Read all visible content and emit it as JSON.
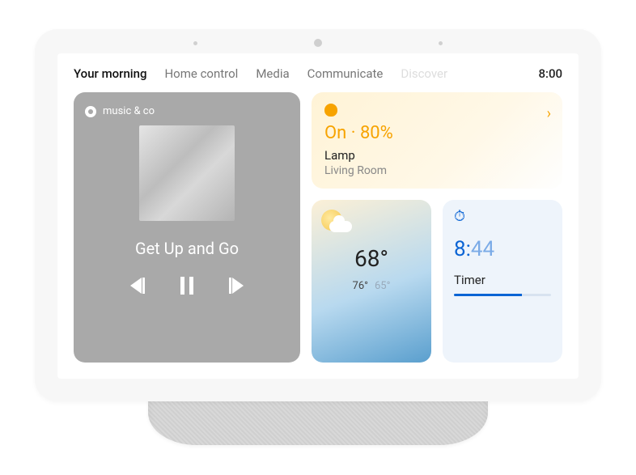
{
  "nav": {
    "tabs": [
      "Your morning",
      "Home control",
      "Media",
      "Communicate",
      "Discover"
    ],
    "active": 0,
    "clock": "8:00"
  },
  "music": {
    "source": "music & co",
    "track": "Get Up and Go"
  },
  "light": {
    "status": "On · 80%",
    "name": "Lamp",
    "room": "Living Room"
  },
  "weather": {
    "temp": "68°",
    "high": "76°",
    "low": "65°"
  },
  "timer": {
    "hours": "8:",
    "mins": "44",
    "label": "Timer",
    "progress": 70
  }
}
